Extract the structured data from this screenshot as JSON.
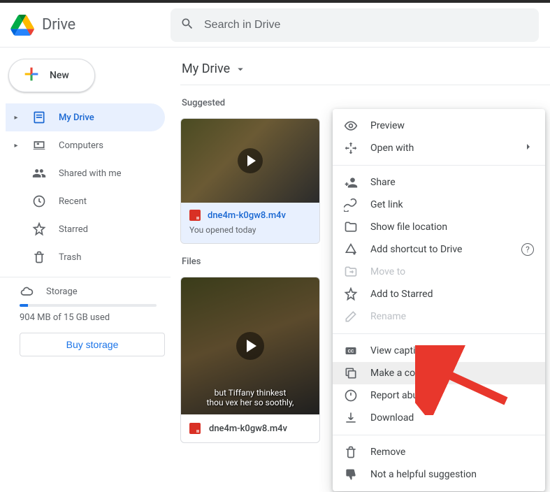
{
  "header": {
    "app_name": "Drive",
    "search_placeholder": "Search in Drive"
  },
  "new_button": {
    "label": "New"
  },
  "sidebar": {
    "items": [
      {
        "label": "My Drive"
      },
      {
        "label": "Computers"
      },
      {
        "label": "Shared with me"
      },
      {
        "label": "Recent"
      },
      {
        "label": "Starred"
      },
      {
        "label": "Trash"
      }
    ],
    "storage_label": "Storage",
    "storage_text": "904 MB of 15 GB used",
    "buy_label": "Buy storage"
  },
  "main": {
    "breadcrumb": "My Drive",
    "suggested_title": "Suggested",
    "files_title": "Files",
    "suggested_card": {
      "filename": "dne4m-k0gw8.m4v",
      "subtitle": "You opened today"
    },
    "file_card": {
      "filename": "dne4m-k0gw8.m4v",
      "caption_line1": "but Tiffany thinkest",
      "caption_line2": "thou vex her so soothly,"
    }
  },
  "context_menu": {
    "preview": "Preview",
    "open_with": "Open with",
    "share": "Share",
    "get_link": "Get link",
    "show_location": "Show file location",
    "add_shortcut": "Add shortcut to Drive",
    "move_to": "Move to",
    "add_starred": "Add to Starred",
    "rename": "Rename",
    "view_caption": "View caption tracks",
    "make_copy": "Make a copy",
    "report_abuse": "Report abuse",
    "download": "Download",
    "remove": "Remove",
    "not_helpful": "Not a helpful suggestion"
  }
}
